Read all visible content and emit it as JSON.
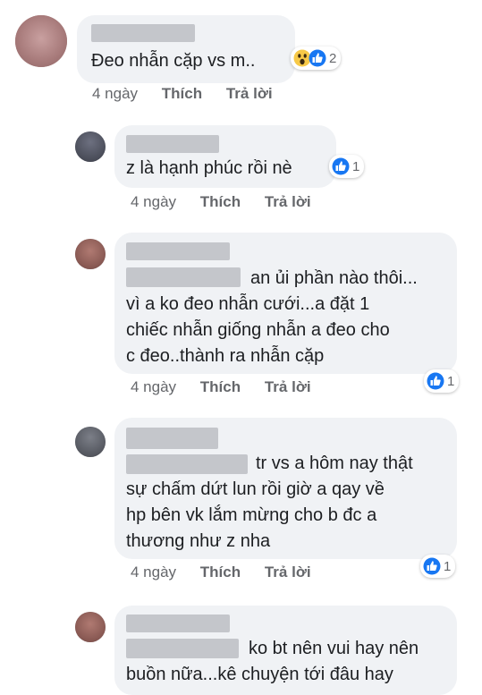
{
  "comments": [
    {
      "text_lines": [
        "Đeo nhẫn cặp vs m.."
      ],
      "time": "4 ngày",
      "like": "Thích",
      "reply": "Trả lời",
      "reaction_count": "2",
      "reactions": [
        "wow-icon",
        "like-icon"
      ]
    },
    {
      "text_lines": [
        "z là hạnh phúc rồi nè"
      ],
      "time": "4 ngày",
      "like": "Thích",
      "reply": "Trả lời",
      "reaction_count": "1",
      "reactions": [
        "like-icon"
      ]
    },
    {
      "text_lines": [
        "an ủi phần nào thôi...",
        "vì a ko đeo nhẫn cưới...a đặt 1",
        "chiếc nhẫn giống nhẫn a đeo cho",
        "c đeo..thành ra nhẫn cặp"
      ],
      "time": "4 ngày",
      "like": "Thích",
      "reply": "Trả lời",
      "reaction_count": "1",
      "reactions": [
        "like-icon"
      ]
    },
    {
      "text_lines": [
        "tr vs a hôm nay thật",
        "sự chấm dứt lun rồi giờ a qay về",
        "hp bên vk lắm mừng cho b đc a",
        "thương như z nha"
      ],
      "time": "4 ngày",
      "like": "Thích",
      "reply": "Trả lời",
      "reaction_count": "1",
      "reactions": [
        "like-icon"
      ]
    },
    {
      "text_lines": [
        "ko bt nên vui hay nên",
        "buồn nữa...kê chuyện tới đâu hay"
      ]
    }
  ],
  "colors": {
    "bubble": "#f0f2f5",
    "redaction": "#c4c6cb",
    "like_blue": "#1877f2",
    "wow_yellow": "#f7c948",
    "meta_gray": "#65676b"
  }
}
